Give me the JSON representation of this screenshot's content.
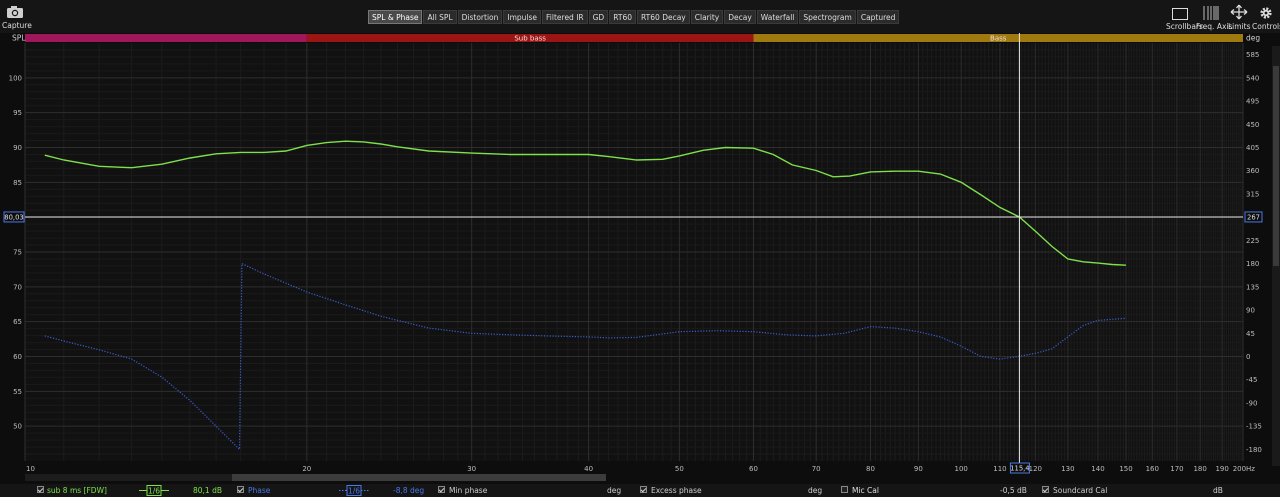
{
  "toolbar": {
    "capture_label": "Capture",
    "tabs": [
      {
        "label": "SPL & Phase",
        "active": true
      },
      {
        "label": "All SPL"
      },
      {
        "label": "Distortion"
      },
      {
        "label": "Impulse"
      },
      {
        "label": "Filtered IR"
      },
      {
        "label": "GD"
      },
      {
        "label": "RT60"
      },
      {
        "label": "RT60 Decay"
      },
      {
        "label": "Clarity"
      },
      {
        "label": "Decay"
      },
      {
        "label": "Waterfall"
      },
      {
        "label": "Spectrogram"
      },
      {
        "label": "Captured"
      }
    ],
    "right": {
      "scrollbars_label": "Scrollbars",
      "freq_axis_label": "Freq. Axis",
      "limits_label": "Limits",
      "controls_label": "Controls"
    }
  },
  "plot": {
    "left_axis_title": "SPL",
    "right_axis_title": "deg",
    "bands": [
      {
        "label": "",
        "color": "#a0175c",
        "from": 10,
        "to": 20
      },
      {
        "label": "Sub bass",
        "color": "#9c1515",
        "from": 20,
        "to": 60
      },
      {
        "label": "Bass",
        "color": "#a07a0e",
        "from": 60,
        "to": 200
      }
    ],
    "spl_ticks": [
      "50",
      "55",
      "60",
      "65",
      "70",
      "75",
      "80",
      "85",
      "90",
      "95",
      "100"
    ],
    "deg_ticks": [
      "-180",
      "-135",
      "-90",
      "-45",
      "0",
      "45",
      "90",
      "135",
      "180",
      "225",
      "270",
      "315",
      "360",
      "405",
      "450",
      "495",
      "540",
      "585"
    ],
    "freq_ticks": [
      {
        "f": 10,
        "label": "10"
      },
      {
        "f": 20,
        "label": "20"
      },
      {
        "f": 30,
        "label": "30"
      },
      {
        "f": 40,
        "label": "40"
      },
      {
        "f": 50,
        "label": "50"
      },
      {
        "f": 60,
        "label": "60"
      },
      {
        "f": 70,
        "label": "70"
      },
      {
        "f": 80,
        "label": "80"
      },
      {
        "f": 90,
        "label": "90"
      },
      {
        "f": 100,
        "label": "100"
      },
      {
        "f": 110,
        "label": "110"
      },
      {
        "f": 120,
        "label": "120"
      },
      {
        "f": 130,
        "label": "130"
      },
      {
        "f": 140,
        "label": "140"
      },
      {
        "f": 150,
        "label": "150"
      },
      {
        "f": 160,
        "label": "160"
      },
      {
        "f": 170,
        "label": "170"
      },
      {
        "f": 180,
        "label": "180"
      },
      {
        "f": 190,
        "label": "190"
      },
      {
        "f": 200,
        "label": "200Hz"
      }
    ],
    "cursor": {
      "freq": 115.4,
      "freq_label": "115,4",
      "spl_label": "80,03",
      "deg_label": "267"
    }
  },
  "chart_data": {
    "type": "line",
    "xlabel": "",
    "x_scale": "log",
    "xlim": [
      10,
      200
    ],
    "ylabel": "SPL",
    "ylim": [
      45,
      105
    ],
    "y2label": "deg",
    "y2lim": [
      -202.5,
      607.5
    ],
    "grid": true,
    "series": [
      {
        "name": "sub 8 ms [FDW]",
        "axis": "left",
        "color": "#7ee04a",
        "style": "solid",
        "x": [
          10.5,
          11,
          12,
          13,
          14,
          15,
          16,
          17,
          18,
          19,
          20,
          21,
          22,
          23,
          24,
          25,
          27,
          30,
          33,
          36,
          40,
          42,
          45,
          48,
          50,
          53,
          56,
          60,
          63,
          66,
          70,
          73,
          76,
          80,
          85,
          90,
          95,
          100,
          105,
          110,
          115.4,
          120,
          125,
          130,
          135,
          140,
          145,
          150
        ],
        "y": [
          88.9,
          88.2,
          87.3,
          87.1,
          87.6,
          88.5,
          89.1,
          89.3,
          89.3,
          89.5,
          90.3,
          90.7,
          90.9,
          90.8,
          90.5,
          90.1,
          89.5,
          89.2,
          89.0,
          89.0,
          89.0,
          88.7,
          88.2,
          88.3,
          88.8,
          89.6,
          90.0,
          89.9,
          89.0,
          87.5,
          86.7,
          85.8,
          85.9,
          86.5,
          86.6,
          86.6,
          86.2,
          85.0,
          83.2,
          81.4,
          80.03,
          78.0,
          75.8,
          74.0,
          73.6,
          73.4,
          73.2,
          73.1
        ]
      },
      {
        "name": "Phase",
        "axis": "right",
        "color": "#3b5fd0",
        "style": "dotted",
        "x": [
          10.5,
          11,
          12,
          13,
          14,
          15,
          16,
          16.95,
          17.05,
          18,
          19,
          20,
          22,
          24,
          27,
          30,
          33,
          36,
          40,
          42,
          45,
          50,
          55,
          60,
          65,
          70,
          75,
          80,
          85,
          90,
          95,
          100,
          105,
          110,
          115,
          120,
          125,
          130,
          135,
          140,
          145,
          150
        ],
        "y": [
          40,
          30,
          13,
          -5,
          -40,
          -85,
          -135,
          -180,
          180,
          160,
          142,
          125,
          100,
          78,
          55,
          45,
          42,
          40,
          38,
          36,
          37,
          48,
          50,
          48,
          42,
          40,
          45,
          58,
          55,
          48,
          38,
          20,
          0,
          -5,
          0,
          6,
          15,
          38,
          60,
          70,
          72,
          74
        ]
      }
    ]
  },
  "legend": {
    "trace_name": "sub 8 ms [FDW]",
    "smoothing": "1/6",
    "spl_value": "80,1 dB",
    "phase_label": "Phase",
    "phase_smoothing": "1/6",
    "phase_value": "-8,8 deg",
    "min_phase_label": "Min phase",
    "min_phase_unit": "deg",
    "excess_phase_label": "Excess phase",
    "excess_phase_unit": "deg",
    "mic_cal_label": "Mic Cal",
    "mic_cal_value": "-0,5 dB",
    "soundcard_cal_label": "Soundcard Cal",
    "soundcard_cal_unit": "dB",
    "colors": {
      "spl": "#7ee04a",
      "phase": "#3b5fd0"
    }
  }
}
